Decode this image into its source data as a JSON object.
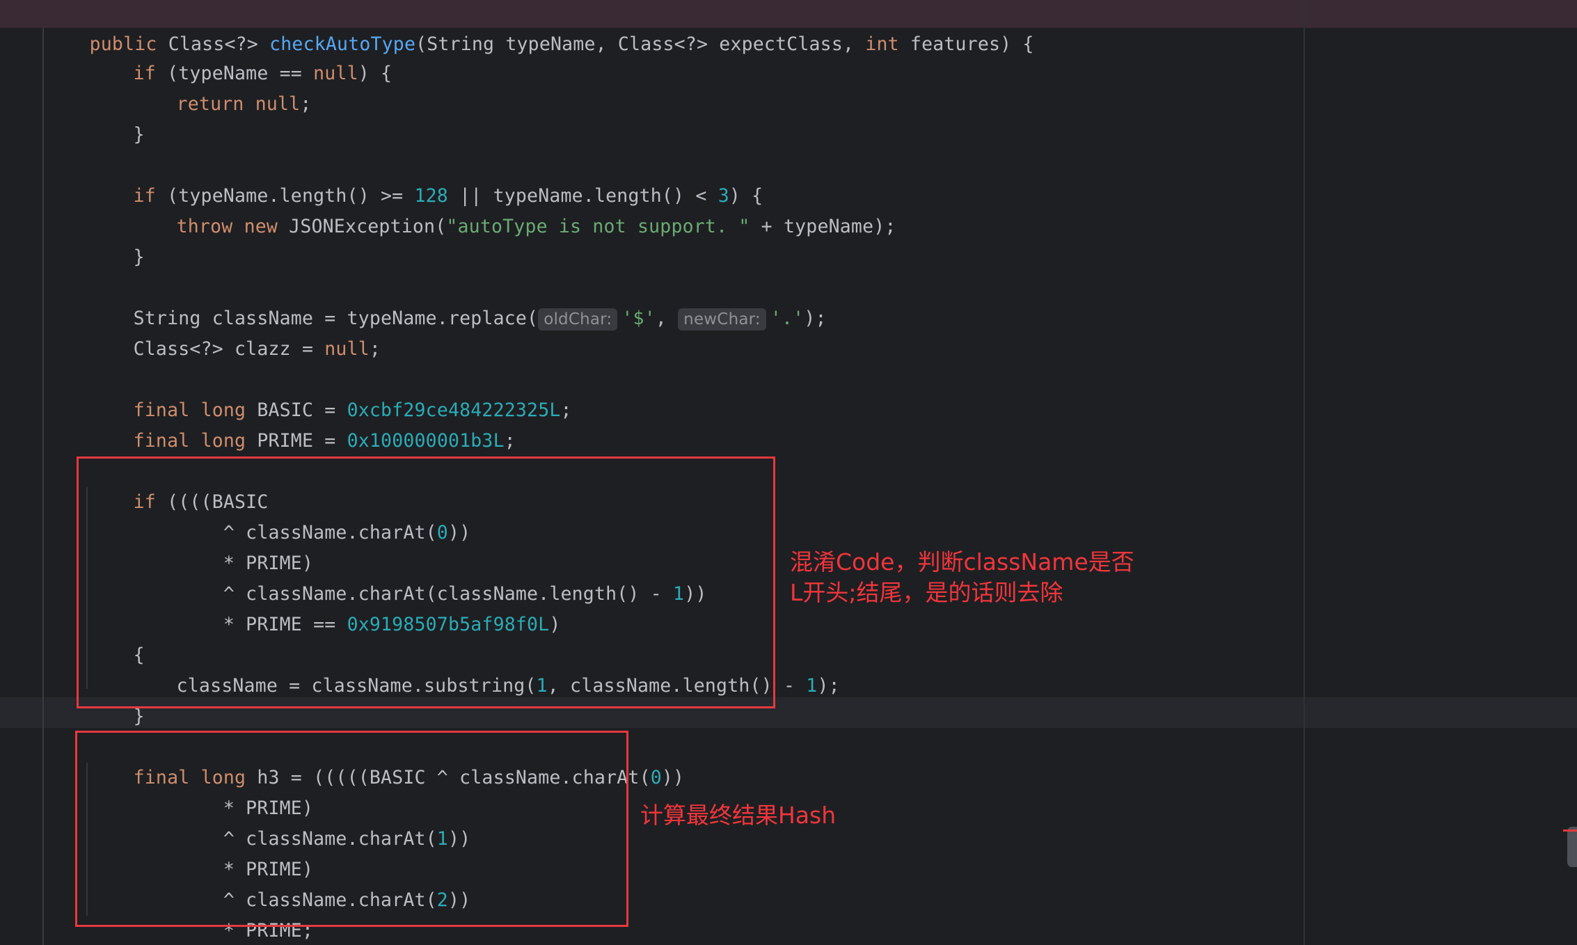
{
  "code": {
    "l1": [
      "public",
      " Class<?> ",
      "checkAutoType",
      "(String typeName, Class<?> expectClass, ",
      "int",
      " features) {"
    ],
    "l2": [
      "if",
      " (typeName == ",
      "null",
      ") {"
    ],
    "l3": [
      "return",
      " ",
      "null",
      ";"
    ],
    "l4": "}",
    "l5": [
      "if",
      " (typeName.length() >= ",
      "128",
      " || typeName.length() < ",
      "3",
      ") {"
    ],
    "l6": [
      "throw",
      " ",
      "new",
      " JSONException(",
      "\"autoType is not support. \"",
      " + typeName);"
    ],
    "l7": "}",
    "l8": {
      "a": "String className = typeName.replace(",
      "hint1": "oldChar:",
      "s1": "'$'",
      "b": ", ",
      "hint2": "newChar:",
      "s2": "'.'",
      "c": ");"
    },
    "l9": [
      "Class<?> clazz = ",
      "null",
      ";"
    ],
    "l10": [
      "final",
      " ",
      "long",
      " BASIC = ",
      "0xcbf29ce484222325L",
      ";"
    ],
    "l11": [
      "final",
      " ",
      "long",
      " PRIME = ",
      "0x100000001b3L",
      ";"
    ],
    "l12": [
      "if",
      " ((((BASIC"
    ],
    "l13": [
      "        ^ className.charAt(",
      "0",
      "))"
    ],
    "l14": "        * PRIME)",
    "l15": [
      "        ^ className.charAt(className.length() - ",
      "1",
      "))"
    ],
    "l16": [
      "        * PRIME == ",
      "0x9198507b5af98f0L",
      ")"
    ],
    "l17": "{",
    "l18": [
      "className = className.substring(",
      "1",
      ", className.length() - ",
      "1",
      ");"
    ],
    "l19": "}",
    "l20": [
      "final",
      " ",
      "long",
      " h3 = (((((BASIC ^ className.charAt(",
      "0",
      "))"
    ],
    "l21": "        * PRIME)",
    "l22": [
      "        ^ className.charAt(",
      "1",
      "))"
    ],
    "l23": "        * PRIME)",
    "l24": [
      "        ^ className.charAt(",
      "2",
      "))"
    ],
    "l25": "        * PRIME;"
  },
  "annotations": {
    "note1_line1": "混淆Code，判断className是否",
    "note1_line2": "L开头;结尾，是的话则去除",
    "note2": "计算最终结果Hash"
  },
  "colors": {
    "background": "#1e1f22",
    "keyword": "#cf8e6d",
    "function": "#56a8f5",
    "number": "#2aacb8",
    "string": "#6aab73",
    "annotation": "#f0363c"
  }
}
